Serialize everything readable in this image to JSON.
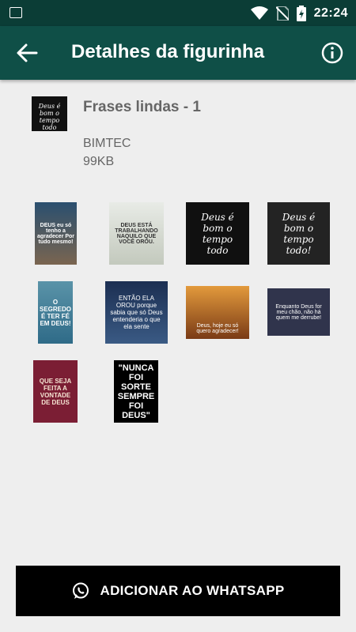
{
  "status_bar": {
    "time": "22:24"
  },
  "app_bar": {
    "title": "Detalhes da figurinha"
  },
  "pack": {
    "thumbnail_text": "Deus é bom o tempo todo",
    "name": "Frases lindas - 1",
    "author": "BIMTEC",
    "size": "99KB"
  },
  "stickers": [
    {
      "text": "DEUS eu só tenho a agradecer Por tudo mesmo!"
    },
    {
      "text": "DEUS ESTÁ TRABALHANDO NAQUILO QUE VOCÊ OROU."
    },
    {
      "text": "Deus é bom o tempo todo"
    },
    {
      "text": "Deus é bom o tempo todo!"
    },
    {
      "text": "O SEGREDO É TER FÉ EM DEUS!"
    },
    {
      "text": "ENTÃO ELA OROU porque sabia que só Deus entenderia o que ela sente"
    },
    {
      "text": "Deus, hoje eu só quero agradecer!"
    },
    {
      "text": "Enquanto Deus for meu chão, não há quem me derrube!"
    },
    {
      "text": "QUE SEJA FEITA A VONTADE DE DEUS"
    },
    {
      "text": "\"NUNCA FOI SORTE SEMPRE FOI DEUS\""
    }
  ],
  "add_button": {
    "label": "ADICIONAR AO WHATSAPP"
  },
  "colors": {
    "status_bar": "#0b3d36",
    "app_bar": "#0f4f47",
    "background": "#eeeeee",
    "button": "#000000"
  }
}
